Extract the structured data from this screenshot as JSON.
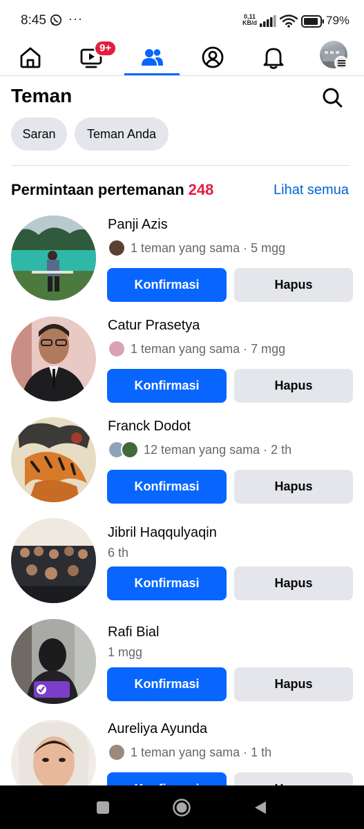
{
  "status_bar": {
    "time": "8:45",
    "dots": "···",
    "speed_value": "0,11",
    "speed_unit": "KB/d",
    "battery": "79%"
  },
  "top_nav": {
    "tabs": [
      {
        "name": "home-icon"
      },
      {
        "name": "video-icon",
        "badge": "9+"
      },
      {
        "name": "friends-icon",
        "active": true
      },
      {
        "name": "profile-icon"
      },
      {
        "name": "bell-icon"
      },
      {
        "name": "avatar-menu"
      }
    ]
  },
  "header": {
    "title": "Teman"
  },
  "chips": [
    "Saran",
    "Teman Anda"
  ],
  "requests_section": {
    "title": "Permintaan pertemanan",
    "count": "248",
    "see_all": "Lihat semua"
  },
  "requests": [
    {
      "name": "Panji Azis",
      "meta": "1 teman yang sama · 5 mgg",
      "mutual_avatars": 1,
      "confirm": "Konfirmasi",
      "delete": "Hapus"
    },
    {
      "name": "Catur Prasetya",
      "meta": "1 teman yang sama · 7 mgg",
      "mutual_avatars": 1,
      "confirm": "Konfirmasi",
      "delete": "Hapus"
    },
    {
      "name": "Franck Dodot",
      "meta": "12 teman yang sama · 2 th",
      "mutual_avatars": 2,
      "confirm": "Konfirmasi",
      "delete": "Hapus"
    },
    {
      "name": "Jibril Haqqulyaqin",
      "meta": "6 th",
      "mutual_avatars": 0,
      "confirm": "Konfirmasi",
      "delete": "Hapus"
    },
    {
      "name": "Rafi Bial",
      "meta": "1 mgg",
      "mutual_avatars": 0,
      "confirm": "Konfirmasi",
      "delete": "Hapus"
    },
    {
      "name": "Aureliya Ayunda",
      "meta": "1 teman yang sama · 1 th",
      "mutual_avatars": 1,
      "confirm": "Konfirmasi",
      "delete": "Hapus"
    }
  ],
  "colors": {
    "accent": "#0866ff",
    "badge": "#e41e3f",
    "link": "#0064d1",
    "secondary_button": "#e4e6eb"
  }
}
